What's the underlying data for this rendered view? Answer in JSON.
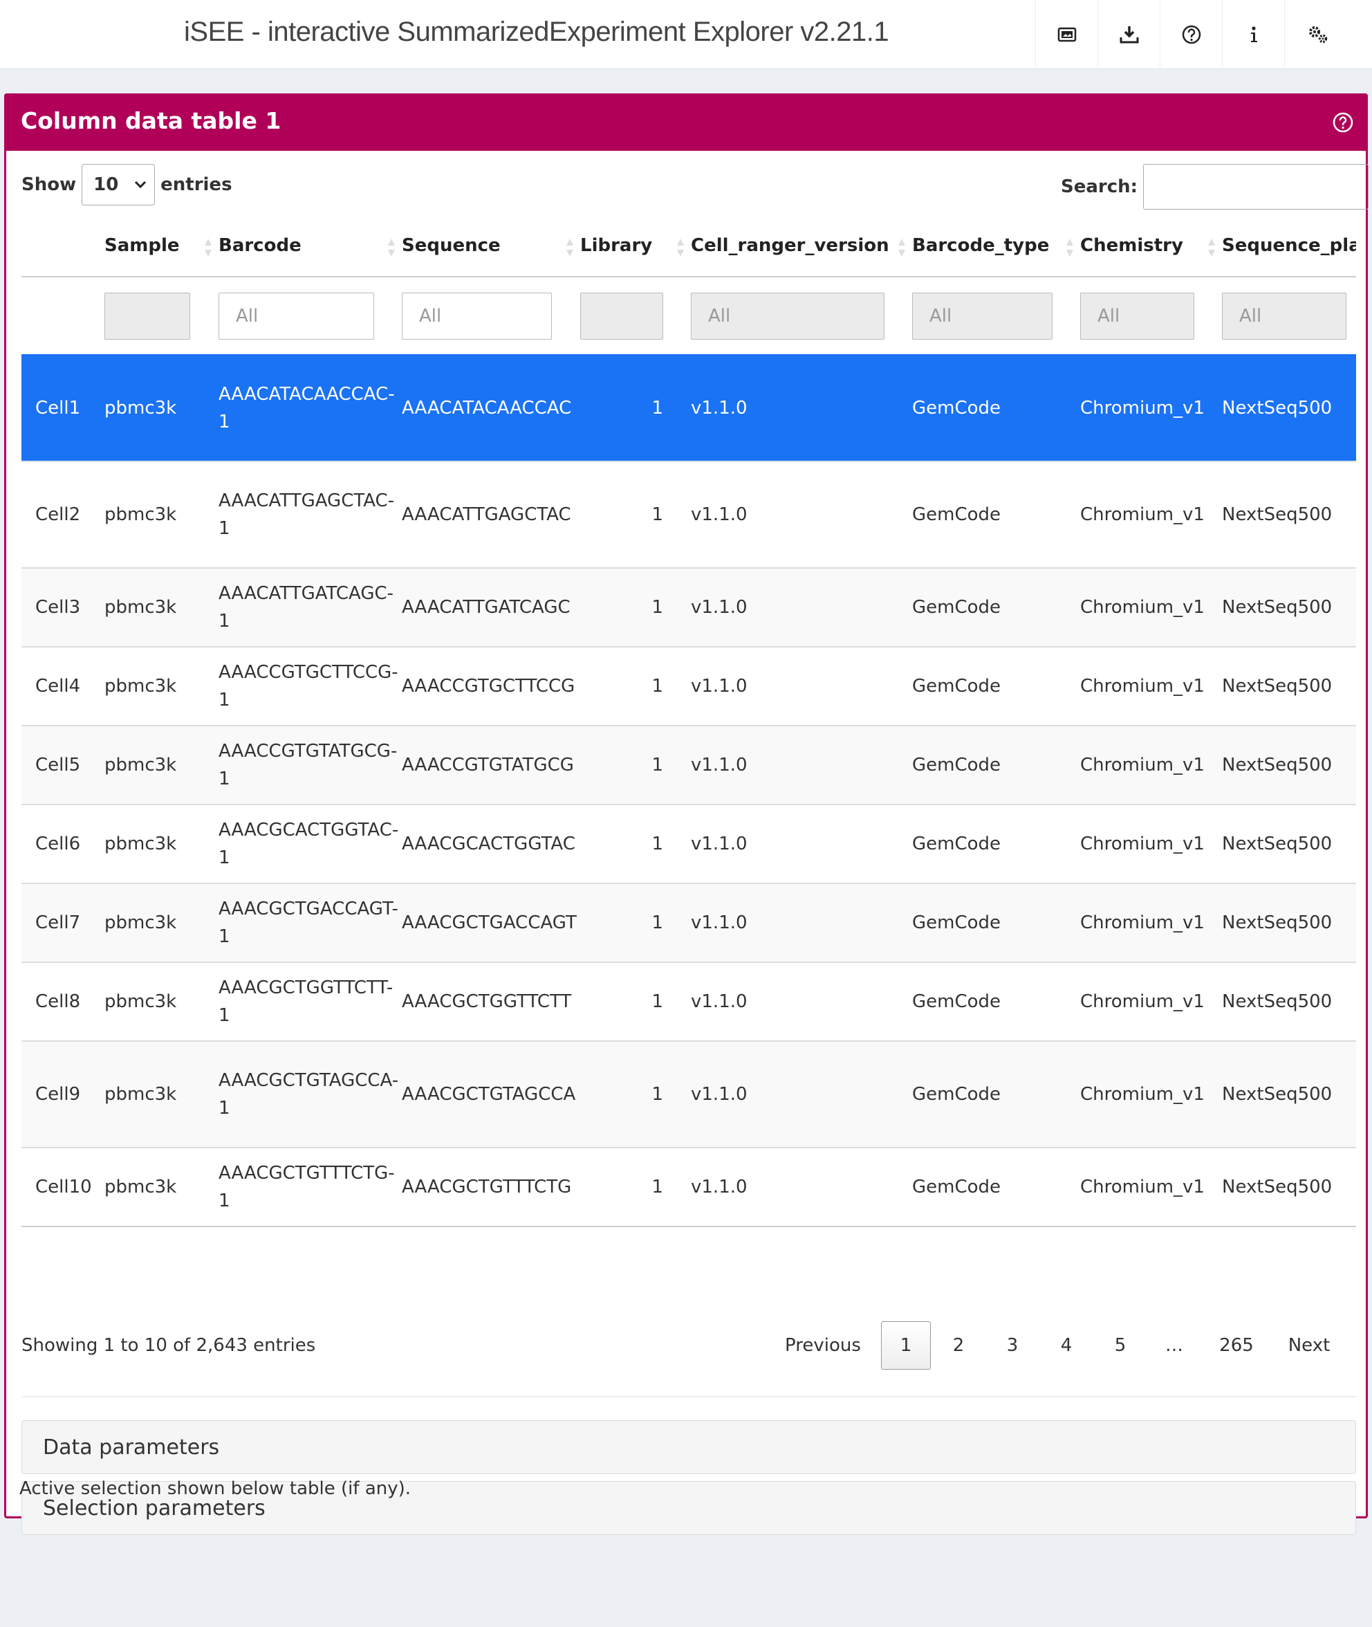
{
  "header": {
    "title": "iSEE - interactive SummarizedExperiment Explorer v2.21.1",
    "icons": [
      "screenshot-icon",
      "download-icon",
      "help-circle-icon",
      "info-icon",
      "settings-gears-icon"
    ]
  },
  "panel": {
    "title": "Column data table 1",
    "accent_color": "#b00058"
  },
  "controls": {
    "show_label": "Show",
    "entries_value": "10",
    "entries_label": "entries",
    "search_label": "Search:"
  },
  "table": {
    "columns": [
      "",
      "Sample",
      "Barcode",
      "Sequence",
      "Library",
      "Cell_ranger_version",
      "Barcode_type",
      "Chemistry",
      "Sequence_plat"
    ],
    "filters": [
      "",
      "",
      "All",
      "All",
      "",
      "All",
      "All",
      "All",
      "All"
    ],
    "rows": [
      [
        "Cell1",
        "pbmc3k",
        "AAACATACAACCAC-1",
        "AAACATACAACCAC",
        "1",
        "v1.1.0",
        "GemCode",
        "Chromium_v1",
        "NextSeq500"
      ],
      [
        "Cell2",
        "pbmc3k",
        "AAACATTGAGCTAC-1",
        "AAACATTGAGCTAC",
        "1",
        "v1.1.0",
        "GemCode",
        "Chromium_v1",
        "NextSeq500"
      ],
      [
        "Cell3",
        "pbmc3k",
        "AAACATTGATCAGC-1",
        "AAACATTGATCAGC",
        "1",
        "v1.1.0",
        "GemCode",
        "Chromium_v1",
        "NextSeq500"
      ],
      [
        "Cell4",
        "pbmc3k",
        "AAACCGTGCTTCCG-1",
        "AAACCGTGCTTCCG",
        "1",
        "v1.1.0",
        "GemCode",
        "Chromium_v1",
        "NextSeq500"
      ],
      [
        "Cell5",
        "pbmc3k",
        "AAACCGTGTATGCG-1",
        "AAACCGTGTATGCG",
        "1",
        "v1.1.0",
        "GemCode",
        "Chromium_v1",
        "NextSeq500"
      ],
      [
        "Cell6",
        "pbmc3k",
        "AAACGCACTGGTAC-1",
        "AAACGCACTGGTAC",
        "1",
        "v1.1.0",
        "GemCode",
        "Chromium_v1",
        "NextSeq500"
      ],
      [
        "Cell7",
        "pbmc3k",
        "AAACGCTGACCAGT-1",
        "AAACGCTGACCAGT",
        "1",
        "v1.1.0",
        "GemCode",
        "Chromium_v1",
        "NextSeq500"
      ],
      [
        "Cell8",
        "pbmc3k",
        "AAACGCTGGTTCTT-1",
        "AAACGCTGGTTCTT",
        "1",
        "v1.1.0",
        "GemCode",
        "Chromium_v1",
        "NextSeq500"
      ],
      [
        "Cell9",
        "pbmc3k",
        "AAACGCTGTAGCCA-1",
        "AAACGCTGTAGCCA",
        "1",
        "v1.1.0",
        "GemCode",
        "Chromium_v1",
        "NextSeq500"
      ],
      [
        "Cell10",
        "pbmc3k",
        "AAACGCTGTTTCTG-1",
        "AAACGCTGTTTCTG",
        "1",
        "v1.1.0",
        "GemCode",
        "Chromium_v1",
        "NextSeq500"
      ]
    ],
    "selected_row": "Cell1",
    "selected_color": "#1a72f5"
  },
  "footer": {
    "showing": "Showing 1 to 10 of 2,643 entries",
    "pager": {
      "previous": "Previous",
      "pages": [
        "1",
        "2",
        "3",
        "4",
        "5",
        "…",
        "265"
      ],
      "current": "1",
      "next": "Next"
    }
  },
  "accordions": {
    "data_parameters": "Data parameters",
    "selection_parameters": "Selection parameters"
  },
  "note": "Active selection shown below table (if any)."
}
